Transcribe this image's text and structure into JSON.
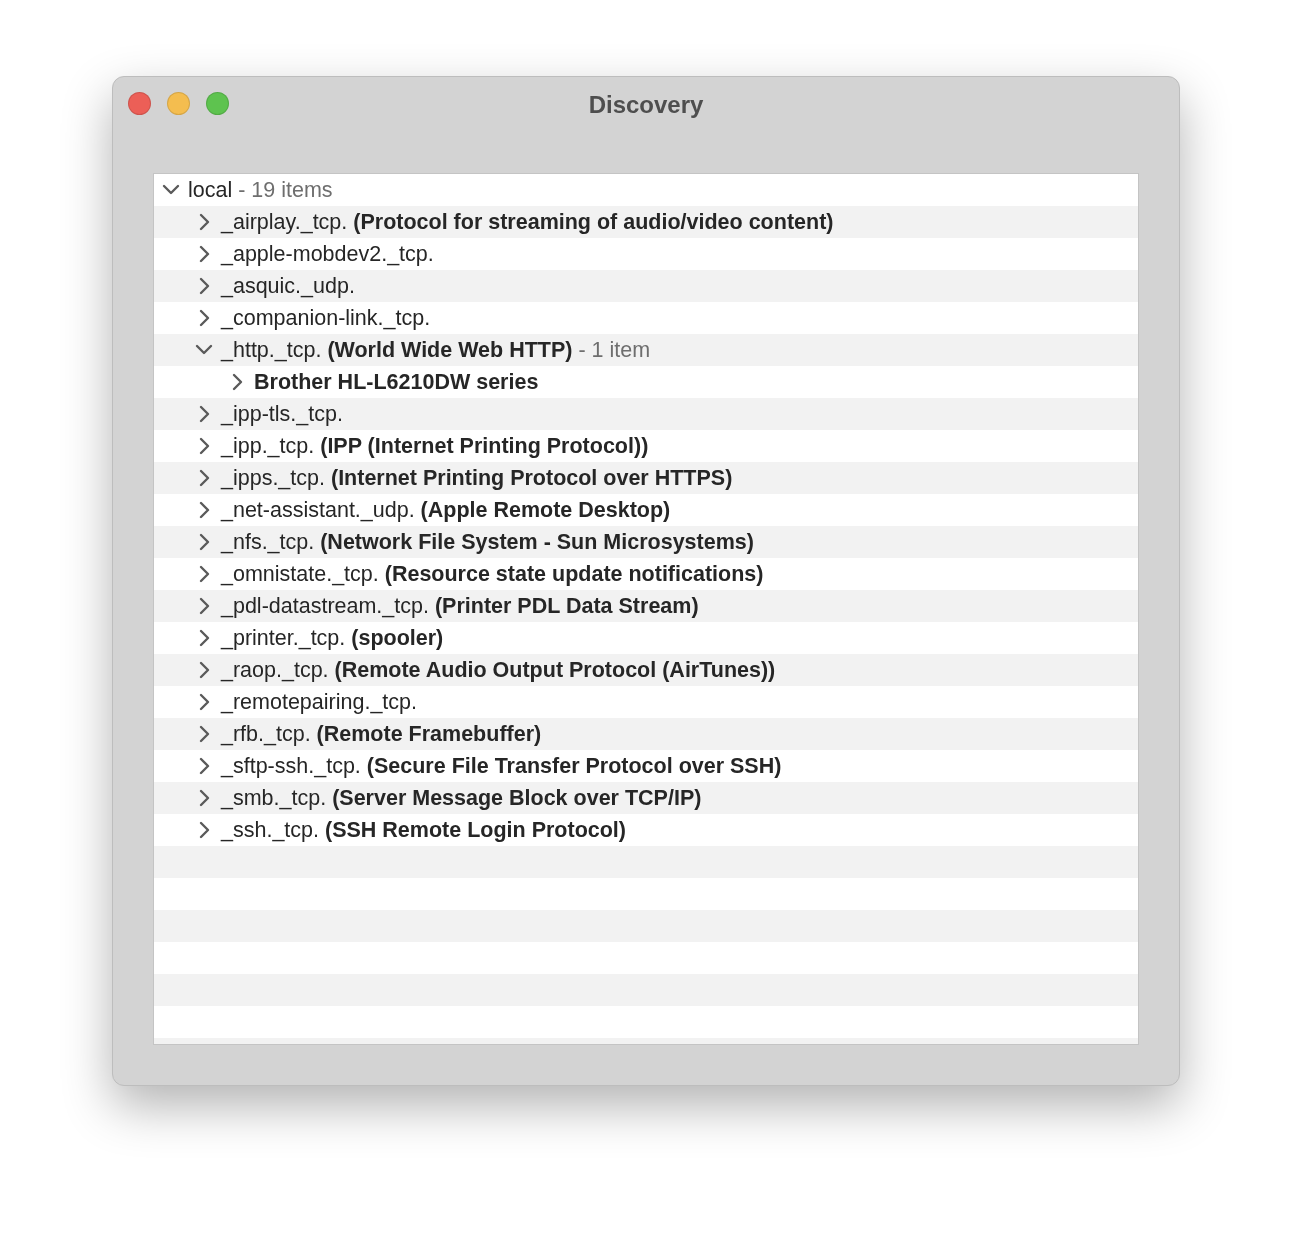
{
  "window": {
    "title": "Discovery"
  },
  "tree": [
    {
      "kind": "domain",
      "label": "local",
      "count": "- 19 items",
      "expanded": true,
      "children": [
        {
          "kind": "service",
          "label": "_airplay._tcp. **(Protocol for streaming of audio/video content)**",
          "expanded": false
        },
        {
          "kind": "service",
          "label": "_apple-mobdev2._tcp.",
          "expanded": false
        },
        {
          "kind": "service",
          "label": "_asquic._udp.",
          "expanded": false
        },
        {
          "kind": "service",
          "label": "_companion-link._tcp.",
          "expanded": false
        },
        {
          "kind": "service",
          "label": "_http._tcp. **(World Wide Web HTTP)**",
          "count": "- 1 item",
          "expanded": true,
          "children": [
            {
              "kind": "device",
              "label": "Brother HL-L6210DW series",
              "expanded": false
            }
          ]
        },
        {
          "kind": "service",
          "label": "_ipp-tls._tcp.",
          "expanded": false
        },
        {
          "kind": "service",
          "label": "_ipp._tcp. **(IPP (Internet Printing Protocol))**",
          "expanded": false
        },
        {
          "kind": "service",
          "label": "_ipps._tcp. **(Internet Printing Protocol over HTTPS)**",
          "expanded": false
        },
        {
          "kind": "service",
          "label": "_net-assistant._udp. **(Apple Remote Desktop)**",
          "expanded": false
        },
        {
          "kind": "service",
          "label": "_nfs._tcp. **(Network File System - Sun Microsystems)**",
          "expanded": false
        },
        {
          "kind": "service",
          "label": "_omnistate._tcp. **(Resource state update notifications)**",
          "expanded": false
        },
        {
          "kind": "service",
          "label": "_pdl-datastream._tcp. **(Printer PDL Data Stream)**",
          "expanded": false
        },
        {
          "kind": "service",
          "label": "_printer._tcp. **(spooler)**",
          "expanded": false
        },
        {
          "kind": "service",
          "label": "_raop._tcp. **(Remote Audio Output Protocol (AirTunes))**",
          "expanded": false
        },
        {
          "kind": "service",
          "label": "_remotepairing._tcp.",
          "expanded": false
        },
        {
          "kind": "service",
          "label": "_rfb._tcp. **(Remote Framebuffer)**",
          "expanded": false
        },
        {
          "kind": "service",
          "label": "_sftp-ssh._tcp. **(Secure File Transfer Protocol over SSH)**",
          "expanded": false
        },
        {
          "kind": "service",
          "label": "_smb._tcp. **(Server Message Block over TCP/IP)**",
          "expanded": false
        },
        {
          "kind": "service",
          "label": "_ssh._tcp. **(SSH Remote Login Protocol)**",
          "expanded": false
        }
      ]
    }
  ]
}
